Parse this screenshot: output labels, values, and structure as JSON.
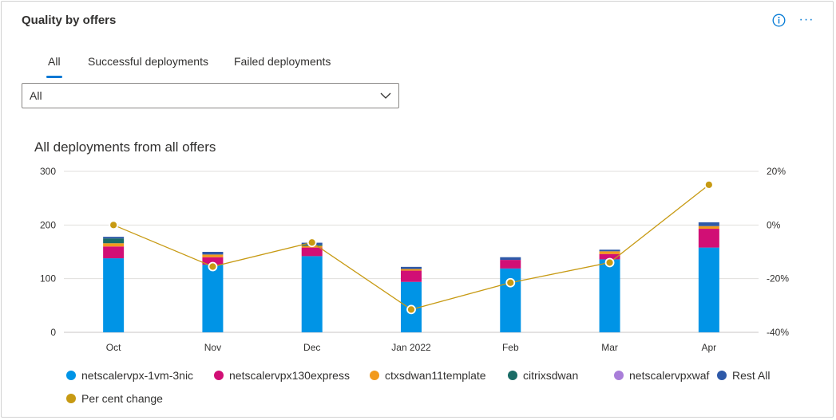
{
  "card": {
    "title": "Quality by offers"
  },
  "icons": {
    "info": "info-icon",
    "more": "more-icon",
    "more_glyph": "···"
  },
  "tabs": [
    {
      "label": "All",
      "active": true
    },
    {
      "label": "Successful deployments",
      "active": false
    },
    {
      "label": "Failed deployments",
      "active": false
    }
  ],
  "filter": {
    "selected": "All"
  },
  "colors": {
    "accent": "#0078d4",
    "series": [
      "#0094e6",
      "#d10f75",
      "#f29a1c",
      "#1a6c66",
      "#a97ed9",
      "#2e59a8"
    ],
    "line": "#c79a13",
    "grid": "#e1dfdd"
  },
  "chart_data": {
    "type": "bar",
    "stacked": true,
    "title": "All deployments from all offers",
    "categories": [
      "Oct",
      "Nov",
      "Dec",
      "Jan 2022",
      "Feb",
      "Mar",
      "Apr"
    ],
    "y_left": {
      "ticks": [
        "300",
        "200",
        "100",
        "0"
      ],
      "ylim": [
        0,
        300
      ]
    },
    "y_right": {
      "ticks": [
        "20%",
        "0%",
        "-20%",
        "-40%"
      ],
      "ylim": [
        -40,
        20
      ]
    },
    "series": [
      {
        "name": "netscalervpx-1vm-3nic",
        "values": [
          138,
          126,
          142,
          94,
          119,
          136,
          158
        ]
      },
      {
        "name": "netscalervpx130express",
        "values": [
          22,
          14,
          16,
          21,
          16,
          10,
          35
        ]
      },
      {
        "name": "ctxsdwan11template",
        "values": [
          6,
          5,
          3,
          3,
          0,
          5,
          5
        ]
      },
      {
        "name": "citrixsdwan",
        "values": [
          9,
          0,
          2,
          0,
          0,
          0,
          0
        ]
      },
      {
        "name": "netscalervpxwaf",
        "values": [
          0,
          0,
          0,
          0,
          0,
          0,
          0
        ]
      },
      {
        "name": "Rest All",
        "values": [
          3,
          5,
          4,
          4,
          5,
          3,
          7
        ]
      }
    ],
    "line_series": {
      "name": "Per cent change",
      "axis": "right",
      "values": [
        0,
        -15.5,
        -6.5,
        -31.5,
        -21.5,
        -14,
        15
      ]
    },
    "grid": true,
    "legend_position": "bottom"
  }
}
